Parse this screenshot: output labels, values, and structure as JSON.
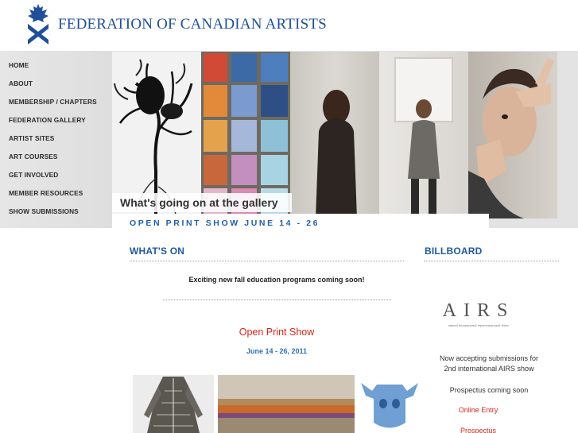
{
  "header": {
    "site_title": "FEDERATION OF CANADIAN ARTISTS",
    "logo_icon": "maple-leaf-easel-logo",
    "brand_color": "#1f4f9a"
  },
  "nav": {
    "items": [
      {
        "label": "HOME"
      },
      {
        "label": "ABOUT"
      },
      {
        "label": "MEMBERSHIP / CHAPTERS"
      },
      {
        "label": "FEDERATION GALLERY"
      },
      {
        "label": "ARTIST SITES"
      },
      {
        "label": "ART COURSES"
      },
      {
        "label": "GET INVOLVED"
      },
      {
        "label": "MEMBER RESOURCES"
      },
      {
        "label": "SHOW SUBMISSIONS"
      }
    ]
  },
  "hero": {
    "heading": "What's going on at the gallery",
    "banner": "OPEN PRINT SHOW JUNE 14 - 26",
    "banner_color": "#1e5fae"
  },
  "whats_on": {
    "title": "WHAT'S ON",
    "note": "Exciting new fall education programs coming soon!",
    "show_title": "Open Print Show",
    "show_dates": "June 14 - 26, 2011",
    "accent_color": "#d4261c"
  },
  "billboard": {
    "title": "BILLBOARD",
    "logo_text": "AIRS",
    "logo_subtext": "annual international representational show",
    "line1": "Now accepting submissions for",
    "line2": "2nd international AIRS show",
    "line3": "Prospectus coming soon",
    "link1": "Online Entry",
    "link2": "Prospectus"
  }
}
